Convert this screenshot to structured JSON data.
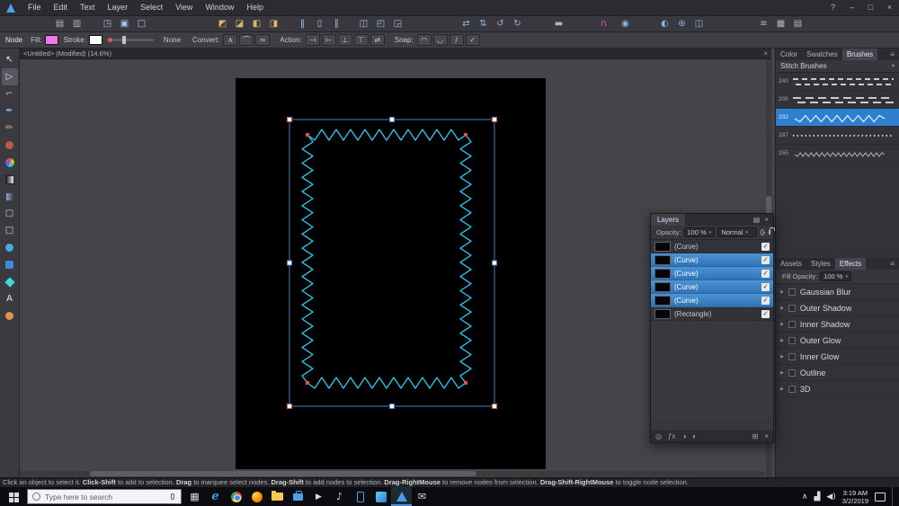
{
  "window": {
    "menus": [
      "File",
      "Edit",
      "Text",
      "Layer",
      "Select",
      "View",
      "Window",
      "Help"
    ],
    "controls": [
      {
        "name": "help",
        "glyph": "?"
      },
      {
        "name": "minimize",
        "glyph": "–"
      },
      {
        "name": "maximize",
        "glyph": "□"
      },
      {
        "name": "close",
        "glyph": "×"
      }
    ]
  },
  "toolbar": {
    "buttons": [
      {
        "name": "snapshot-panel",
        "glyph": "▤",
        "color": "#b4b4bc"
      },
      {
        "name": "resource-manager",
        "glyph": "▥",
        "color": "#b4b4bc"
      },
      {
        "name": "place-image",
        "glyph": "◳",
        "color": "#a8c4e4"
      },
      {
        "name": "group",
        "glyph": "▣",
        "color": "#a8c4e4"
      },
      {
        "name": "ungroup",
        "glyph": "□",
        "color": "#a8c4e4"
      },
      {
        "name": "arrange-to-back",
        "glyph": "◩",
        "color": "#d8b868"
      },
      {
        "name": "arrange-back-one",
        "glyph": "◪",
        "color": "#d8b868"
      },
      {
        "name": "arrange-forward-one",
        "glyph": "◧",
        "color": "#d8b868"
      },
      {
        "name": "arrange-to-front",
        "glyph": "◨",
        "color": "#d8b868"
      },
      {
        "name": "insert-behind",
        "glyph": "‖",
        "color": "#9cc0e8"
      },
      {
        "name": "insert-inside",
        "glyph": "▯",
        "color": "#9cc0e8"
      },
      {
        "name": "insert-on-top",
        "glyph": "∥",
        "color": "#9cc0e8"
      },
      {
        "name": "align-options",
        "glyph": "◫",
        "color": "#9cc0e8"
      },
      {
        "name": "transform-origin",
        "glyph": "◰",
        "color": "#9cc0e8"
      },
      {
        "name": "cycle-selection-box",
        "glyph": "◲",
        "color": "#9cc0e8"
      },
      {
        "name": "flip-horizontal",
        "glyph": "⇄",
        "color": "#88b4e4"
      },
      {
        "name": "flip-vertical",
        "glyph": "⇅",
        "color": "#88b4e4"
      },
      {
        "name": "rotate-ccw",
        "glyph": "↺",
        "color": "#88b4e4"
      },
      {
        "name": "rotate-cw",
        "glyph": "↻",
        "color": "#88b4e4"
      },
      {
        "name": "transparency-mode",
        "glyph": "▬",
        "color": "#b4b4bc"
      },
      {
        "name": "snapping-toggle",
        "glyph": "∩",
        "color": "#e060c8"
      },
      {
        "name": "snapping-assistant",
        "glyph": "◉",
        "color": "#88b4e4"
      },
      {
        "name": "view-quality",
        "glyph": "◐",
        "color": "#88b4e4"
      },
      {
        "name": "zoom-presets",
        "glyph": "⊕",
        "color": "#88b4e4"
      },
      {
        "name": "split-view",
        "glyph": "◫",
        "color": "#88b4e4"
      },
      {
        "name": "toggle-guides",
        "glyph": "≡",
        "color": "#b4b4bc"
      },
      {
        "name": "toggle-grid",
        "glyph": "▦",
        "color": "#b4b4bc"
      },
      {
        "name": "customize-toolbar",
        "glyph": "▤",
        "color": "#b4b4bc"
      }
    ]
  },
  "context": {
    "tool_label": "Node",
    "fill_label": "Fill:",
    "fill_color": "#ee7ce8",
    "stroke_label": "Stroke:",
    "stroke_color": "#ffffff",
    "width_value": "None",
    "convert_label": "Convert:",
    "convert_buttons": [
      {
        "name": "convert-sharp",
        "glyph": "∧"
      },
      {
        "name": "convert-smooth",
        "glyph": "⌒"
      },
      {
        "name": "convert-smart",
        "glyph": "≈"
      }
    ],
    "action_label": "Action:",
    "action_buttons": [
      {
        "name": "action-close-curve",
        "glyph": "⊣"
      },
      {
        "name": "action-break-curve",
        "glyph": "⊢"
      },
      {
        "name": "action-smooth-curve",
        "glyph": "⊥"
      },
      {
        "name": "action-join-curves",
        "glyph": "⊤"
      },
      {
        "name": "action-reverse-curves",
        "glyph": "⇄"
      }
    ],
    "snap_label": "Snap:",
    "snap_buttons": [
      {
        "name": "snap-to-curves",
        "glyph": "◠"
      },
      {
        "name": "snap-off-curves",
        "glyph": "◡"
      },
      {
        "name": "snap-align-handles",
        "glyph": "∕"
      },
      {
        "name": "snap-perform",
        "glyph": "✓"
      }
    ]
  },
  "doc_tab": {
    "title": "<Untitled> (Modified) (14.6%)",
    "close_glyph": "×"
  },
  "tools": [
    {
      "name": "move-tool",
      "glyph": "↖",
      "color": "#e8e8ea"
    },
    {
      "name": "node-tool",
      "glyph": "▷",
      "color": "#d0e0f0"
    },
    {
      "name": "corner-tool",
      "glyph": "⌐",
      "color": "#c8c8ce"
    },
    {
      "name": "pen-tool",
      "glyph": "✒",
      "color": "#80b4e8"
    },
    {
      "name": "pencil-tool",
      "glyph": "✏",
      "color": "#e0a868"
    },
    {
      "name": "vector-brush-tool",
      "color": "#c05848"
    },
    {
      "name": "fill-tool",
      "color": "#multi"
    },
    {
      "name": "gradient-tool",
      "color": "#gradient"
    },
    {
      "name": "transparency-tool",
      "color": "#fade"
    },
    {
      "name": "vector-crop-tool",
      "glyph": "▢",
      "color": "#c8d0d8"
    },
    {
      "name": "rectangle-tool",
      "glyph": "□",
      "color": "#d8d8de"
    },
    {
      "name": "ellipse-tool",
      "color": "#40b0d8"
    },
    {
      "name": "rounded-rectangle-tool",
      "color": "#4088d8"
    },
    {
      "name": "polygon-tool",
      "color": "#40d8d0"
    },
    {
      "name": "artistic-text-tool",
      "glyph": "A",
      "color": "#e8e8ea"
    },
    {
      "name": "color-picker-tool",
      "color": "#e09048"
    }
  ],
  "brushes": {
    "tabs": [
      "Color",
      "Swatches",
      "Brushes"
    ],
    "category": "Stitch Brushes",
    "rows": [
      {
        "num": "240"
      },
      {
        "num": "205"
      },
      {
        "num": "202"
      },
      {
        "num": "287"
      },
      {
        "num": "255"
      }
    ]
  },
  "layers": {
    "title": "Layers",
    "opacity_label": "Opacity:",
    "opacity_value": "100 %",
    "blend_value": "Normal",
    "rows": [
      {
        "name": "(Curve)"
      },
      {
        "name": "(Curve)"
      },
      {
        "name": "(Curve)"
      },
      {
        "name": "(Curve)"
      },
      {
        "name": "(Curve)"
      },
      {
        "name": "(Rectangle)"
      }
    ],
    "foot": [
      {
        "name": "edit-all-layers",
        "glyph": "◎"
      },
      {
        "name": "layer-effects",
        "glyph": "ƒx"
      },
      {
        "name": "mask-layer",
        "glyph": "◑"
      },
      {
        "name": "adjustment-layer",
        "glyph": "◐"
      },
      {
        "name": "add-layer",
        "glyph": "⊞"
      },
      {
        "name": "remove-layer",
        "glyph": "×"
      }
    ]
  },
  "effects": {
    "tabs": [
      "Assets",
      "Styles",
      "Effects"
    ],
    "fill_opacity_label": "Fill Opacity:",
    "fill_opacity_value": "100 %",
    "rows": [
      "Gaussian Blur",
      "Outer Shadow",
      "Inner Shadow",
      "Outer Glow",
      "Inner Glow",
      "Outline",
      "3D"
    ]
  },
  "status": {
    "segments": [
      "Click an object to select it. ",
      "Click-Shift",
      " to add to selection. ",
      "Drag",
      " to marquee select nodes. ",
      "Drag-Shift",
      " to add nodes to selection. ",
      "Drag-RightMouse",
      " to remove nodes from selection. ",
      "Drag-Shift-RightMouse",
      " to toggle node selection."
    ]
  },
  "taskbar": {
    "search_placeholder": "Type here to search",
    "time": "3:19 AM",
    "date": "3/2/2019",
    "icons": [
      {
        "name": "task-view",
        "glyph": "▦",
        "color": "#d8d8dc"
      },
      {
        "name": "edge-browser",
        "glyph": "e"
      },
      {
        "name": "chrome-browser"
      },
      {
        "name": "firefox-browser"
      },
      {
        "name": "file-explorer"
      },
      {
        "name": "microsoft-store"
      },
      {
        "name": "movies-tv",
        "glyph": "▶",
        "color": "#d8d8dc"
      },
      {
        "name": "groove-music",
        "glyph": "♪",
        "color": "#d8d8dc"
      },
      {
        "name": "your-phone"
      },
      {
        "name": "photos"
      },
      {
        "name": "affinity-designer"
      },
      {
        "name": "mail",
        "glyph": "✉",
        "color": "#d8d8dc"
      }
    ],
    "tray": [
      {
        "name": "hidden-icons",
        "glyph": "∧"
      },
      {
        "name": "network",
        "glyph": "▟"
      },
      {
        "name": "volume",
        "glyph": "◀)"
      }
    ]
  }
}
